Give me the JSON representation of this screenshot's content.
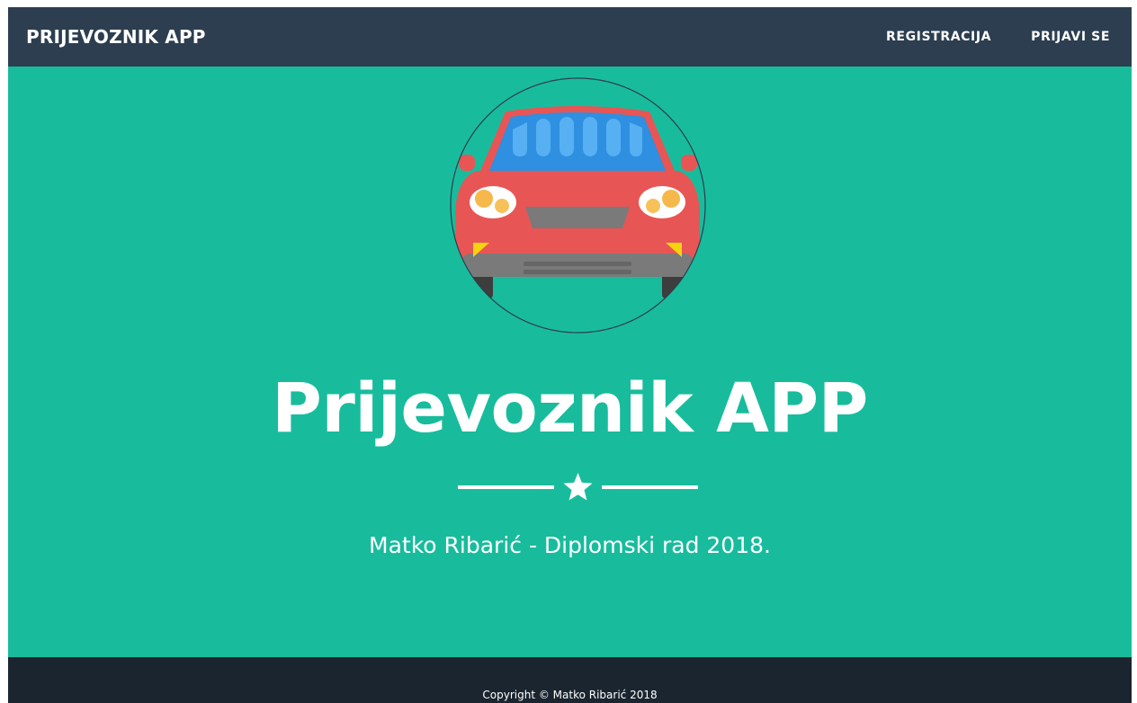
{
  "navbar": {
    "brand": "PRIJEVOZNIK APP",
    "links": [
      {
        "label": "REGISTRACIJA"
      },
      {
        "label": "PRIJAVI SE"
      }
    ]
  },
  "hero": {
    "icon": "car-icon",
    "title": "Prijevoznik APP",
    "divider_icon": "star-icon",
    "subtitle": "Matko Ribarić - Diplomski rad 2018."
  },
  "footer": {
    "copyright": "Copyright © Matko Ribarić 2018"
  },
  "colors": {
    "navbar": "#2c3e50",
    "masthead": "#18bc9c",
    "footer": "#1a252f",
    "car_body": "#e85555",
    "windshield": "#3f9ee8",
    "text": "#ffffff"
  }
}
